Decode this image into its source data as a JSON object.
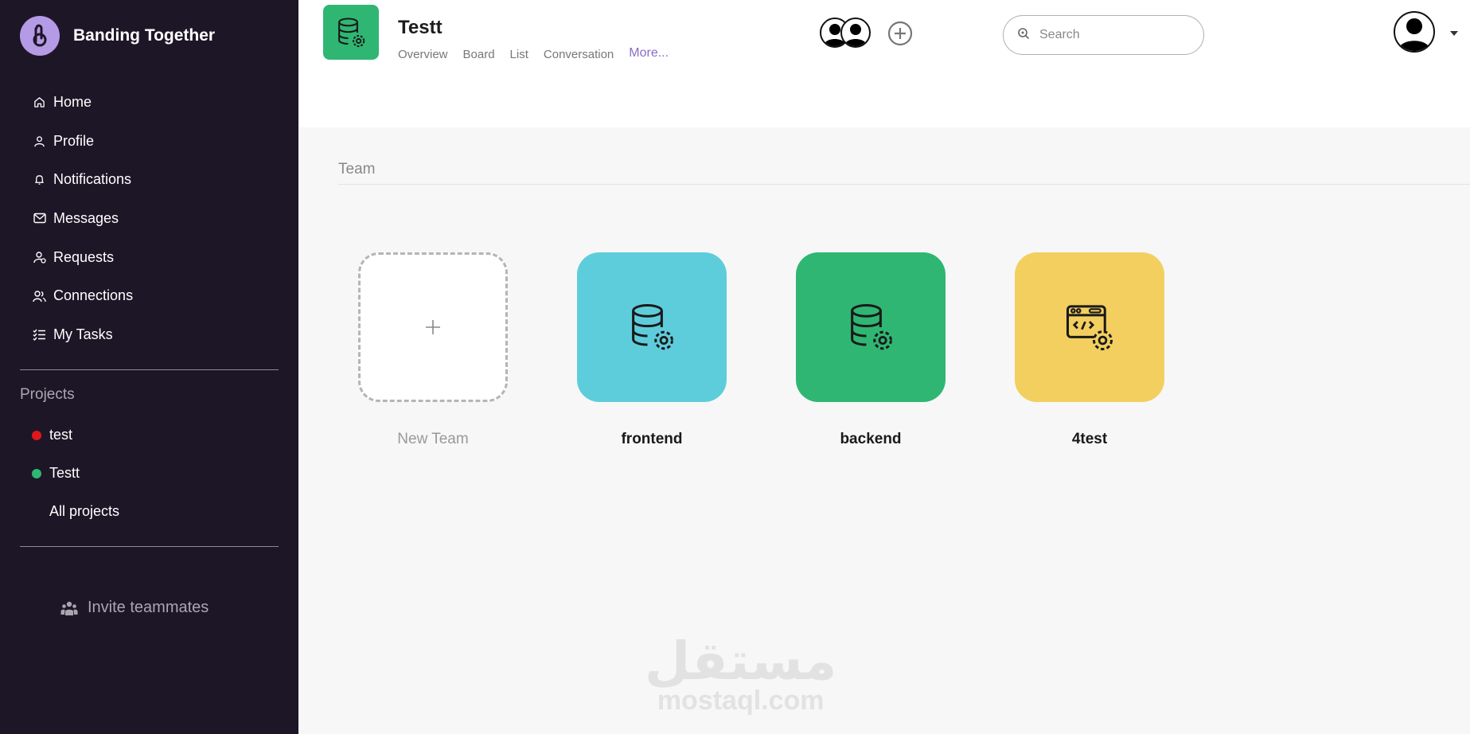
{
  "brand": {
    "name": "Banding Together"
  },
  "nav": [
    {
      "label": "Home",
      "icon": "home-icon"
    },
    {
      "label": "Profile",
      "icon": "user-icon"
    },
    {
      "label": "Notifications",
      "icon": "bell-icon"
    },
    {
      "label": "Messages",
      "icon": "mail-icon"
    },
    {
      "label": "Requests",
      "icon": "user-request-icon"
    },
    {
      "label": "Connections",
      "icon": "users-icon"
    },
    {
      "label": "My Tasks",
      "icon": "task-list-icon"
    }
  ],
  "projects": {
    "label": "Projects",
    "items": [
      {
        "name": "test",
        "color": "#e0171a"
      },
      {
        "name": "Testt",
        "color": "#2fb673"
      }
    ],
    "all_label": "All projects"
  },
  "invite_label": "Invite teammates",
  "header": {
    "title": "Testt",
    "tabs": [
      "Overview",
      "Board",
      "List",
      "Conversation",
      "More..."
    ],
    "search_placeholder": "Search"
  },
  "team": {
    "section_label": "Team",
    "cards": [
      {
        "label": "New Team",
        "type": "new"
      },
      {
        "label": "frontend",
        "color": "#5ecddb",
        "icon": "database-settings-icon"
      },
      {
        "label": "backend",
        "color": "#2fb673",
        "icon": "database-settings-icon"
      },
      {
        "label": "4test",
        "color": "#f3cf60",
        "icon": "web-code-settings-icon"
      }
    ]
  },
  "watermark": {
    "arabic": "مستقل",
    "latin": "mostaql.com"
  },
  "colors": {
    "sidebar_bg": "#1d1627",
    "accent": "#8a6cc9",
    "brand_logo": "#b59ae6"
  }
}
